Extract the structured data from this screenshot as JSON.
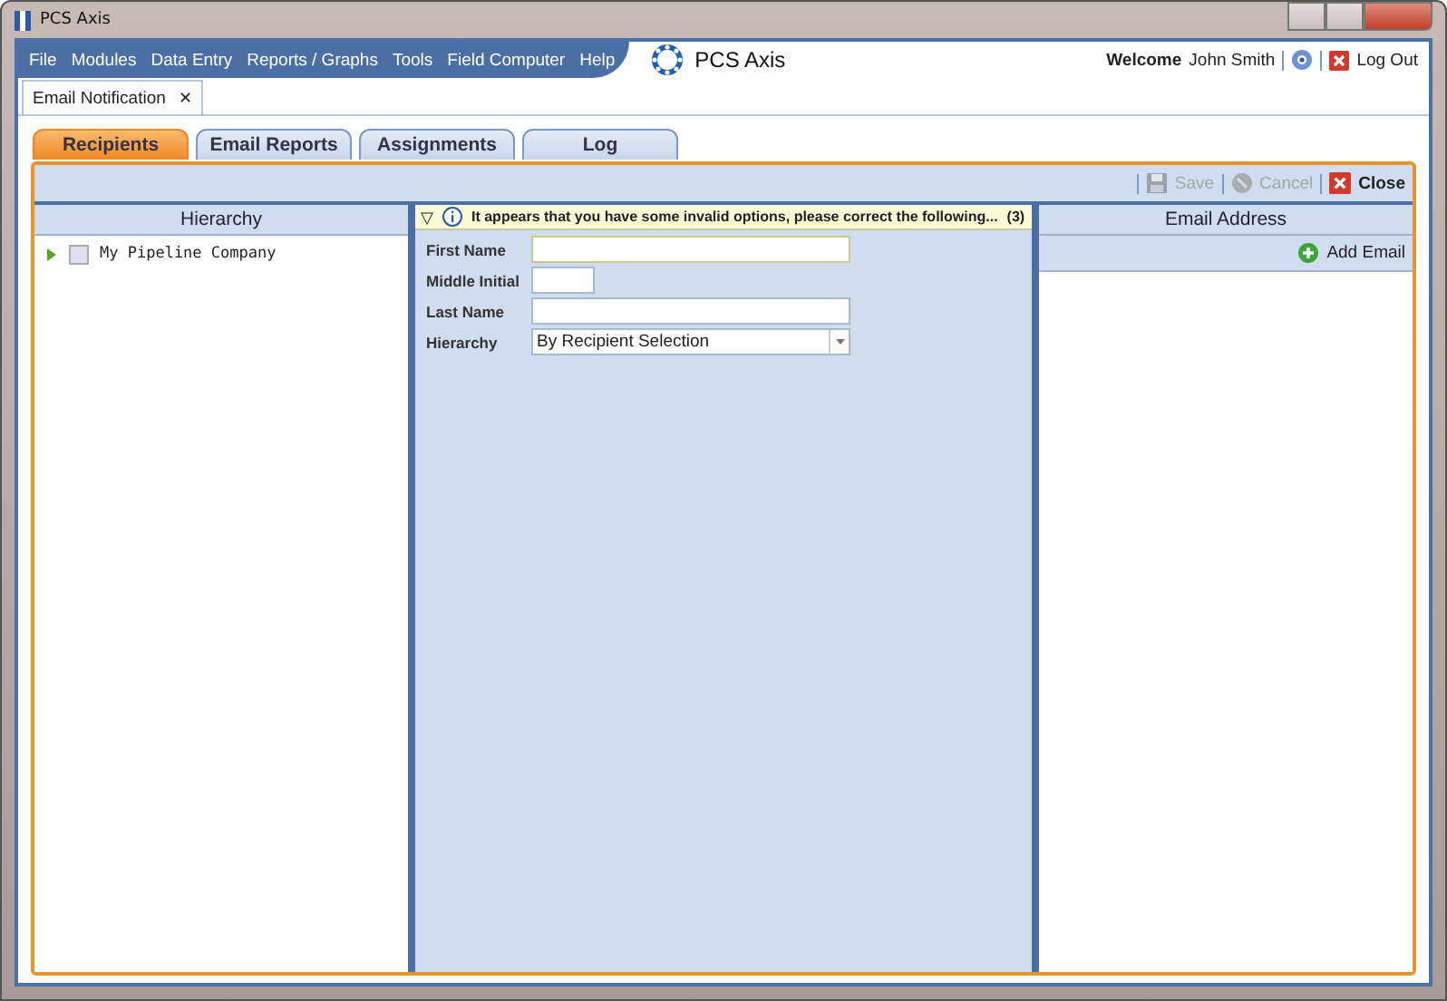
{
  "window": {
    "title": "PCS Axis"
  },
  "menu": [
    "File",
    "Modules",
    "Data Entry",
    "Reports / Graphs",
    "Tools",
    "Field Computer",
    "Help"
  ],
  "brand": "PCS Axis",
  "user": {
    "welcome": "Welcome",
    "name": "John Smith",
    "logout": "Log Out"
  },
  "doc_tabs": [
    {
      "label": "Email Notification",
      "close": "✕",
      "selected": true
    }
  ],
  "tabs": [
    {
      "label": "Recipients",
      "selected": true
    },
    {
      "label": "Email Reports",
      "selected": false
    },
    {
      "label": "Assignments",
      "selected": false
    },
    {
      "label": "Log",
      "selected": false
    }
  ],
  "toolbar": [
    {
      "kind": "save",
      "label": "Save",
      "disabled": true
    },
    {
      "kind": "cancel",
      "label": "Cancel",
      "disabled": true
    },
    {
      "kind": "close",
      "label": "Close",
      "disabled": false
    }
  ],
  "hierarchy": {
    "title": "Hierarchy",
    "items": [
      {
        "label": "My Pipeline Company",
        "checked": false,
        "expanded": false
      }
    ]
  },
  "form": {
    "notice": {
      "toggle": "▽",
      "text": "It appears that you have some invalid options, please correct the following...",
      "count": "(3)"
    },
    "fields": [
      {
        "kind": "text",
        "label": "First Name"
      },
      {
        "kind": "initial",
        "label": "Middle Initial"
      },
      {
        "kind": "text",
        "label": "Last Name"
      },
      {
        "kind": "select",
        "label": "Hierarchy",
        "value": "By Recipient Selection"
      }
    ]
  },
  "email": {
    "title": "Email Address",
    "add": "Add Email"
  }
}
